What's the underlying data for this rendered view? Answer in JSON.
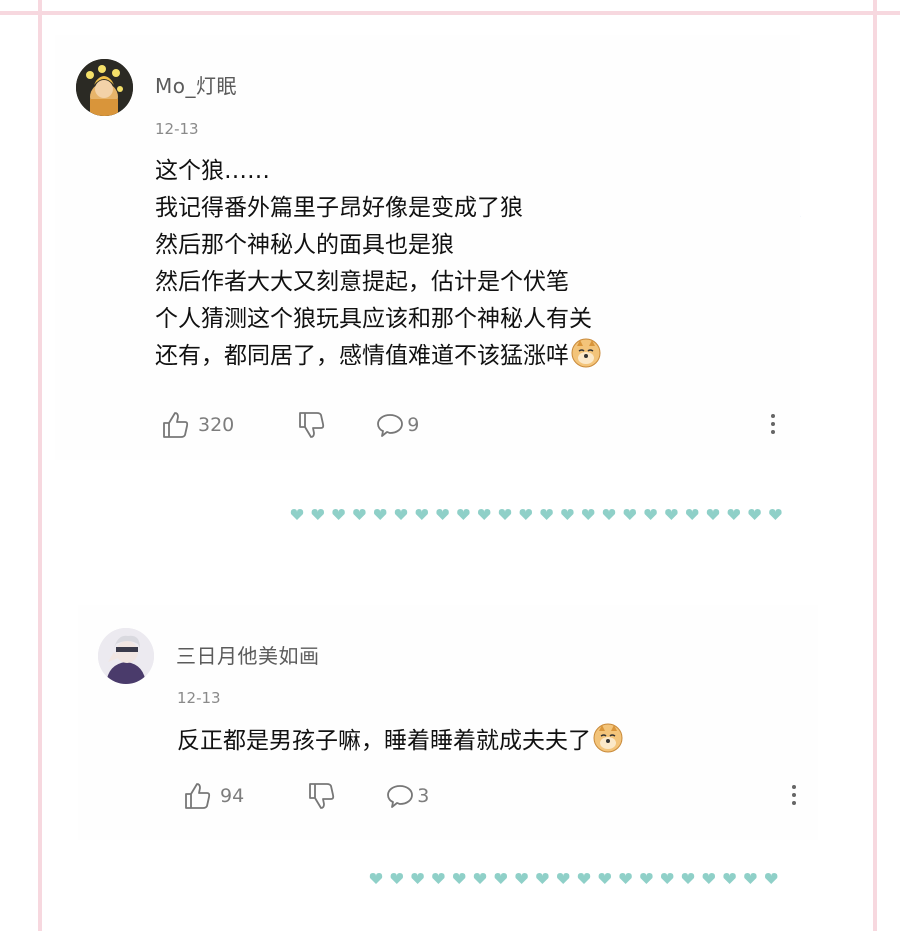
{
  "comments": [
    {
      "username": "Mo_灯眠",
      "date": "12-13",
      "lines": [
        "这个狼……",
        "我记得番外篇里子昂好像是变成了狼",
        "然后那个神秘人的面具也是狼",
        "然后作者大大又刻意提起，估计是个伏笔",
        "个人猜测这个狼玩具应该和那个神秘人有关",
        "还有，都同居了，感情值难道不该猛涨咩"
      ],
      "emoji": "doge-emoji",
      "likes": "320",
      "replies": "9"
    },
    {
      "username": "三日月他美如画",
      "date": "12-13",
      "lines": [
        "反正都是男孩子嘛，睡着睡着就成夫夫了"
      ],
      "emoji": "doge-emoji",
      "likes": "94",
      "replies": "3"
    }
  ],
  "colors": {
    "frame": "#f7d8df",
    "hearts": "#8fd0c8",
    "star": "#dbe8f4"
  },
  "icons": [
    "thumbs-up-icon",
    "thumbs-down-icon",
    "comment-bubble-icon",
    "more-vertical-icon",
    "star-decoration-icon",
    "heart-icon"
  ]
}
